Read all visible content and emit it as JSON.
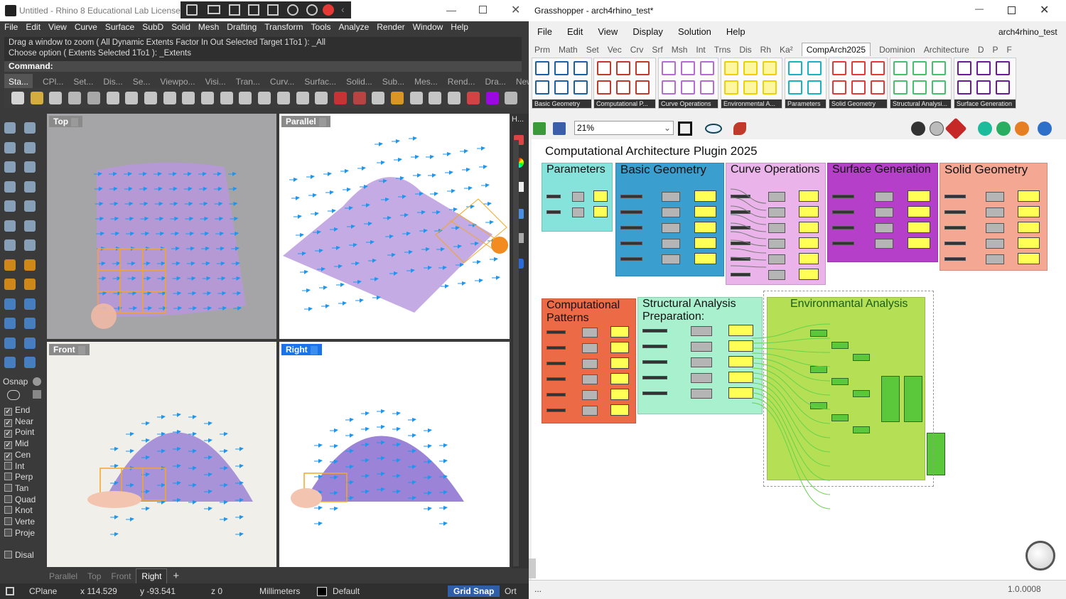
{
  "rhino": {
    "title": "Untitled - Rhino 8 Educational Lab License",
    "menu": [
      "File",
      "Edit",
      "View",
      "Curve",
      "Surface",
      "SubD",
      "Solid",
      "Mesh",
      "Drafting",
      "Transform",
      "Tools",
      "Analyze",
      "Render",
      "Window",
      "Help"
    ],
    "history": [
      "Drag a window to zoom ( All  Dynamic  Extents  Factor  In  Out  Selected  Target  1To1 ): _All",
      "Choose option ( Extents  Selected  1To1 ): _Extents"
    ],
    "command_label": "Command:",
    "toolbar_tabs": [
      "Sta...",
      "CPl...",
      "Set...",
      "Dis...",
      "Se...",
      "Viewpo...",
      "Visi...",
      "Tran...",
      "Curv...",
      "Surfac...",
      "Solid...",
      "Sub...",
      "Mes...",
      "Rend...",
      "Dra...",
      "New..."
    ],
    "viewports": {
      "top": "Top",
      "parallel": "Parallel",
      "front": "Front",
      "right": "Right"
    },
    "view_tabs": [
      "Parallel",
      "Top",
      "Front",
      "Right"
    ],
    "osnap_label": "Osnap",
    "osnaps": [
      {
        "label": "End",
        "checked": true
      },
      {
        "label": "Near",
        "checked": true
      },
      {
        "label": "Point",
        "checked": true
      },
      {
        "label": "Mid",
        "checked": true
      },
      {
        "label": "Cen",
        "checked": true
      },
      {
        "label": "Int",
        "checked": false
      },
      {
        "label": "Perp",
        "checked": false
      },
      {
        "label": "Tan",
        "checked": false
      },
      {
        "label": "Quad",
        "checked": false
      },
      {
        "label": "Knot",
        "checked": false
      },
      {
        "label": "Verte",
        "checked": false
      },
      {
        "label": "Proje",
        "checked": false
      }
    ],
    "disable_label": "Disal",
    "status": {
      "cplane": "CPlane",
      "x": "x 114.529",
      "y": "y -93.541",
      "z": "z 0",
      "units": "Millimeters",
      "layer": "Default",
      "grid_snap": "Grid Snap",
      "ortho": "Ort"
    },
    "right_panel_label": "H..."
  },
  "gh": {
    "title": "Grasshopper - arch4rhino_test*",
    "menu": [
      "File",
      "Edit",
      "View",
      "Display",
      "Solution",
      "Help"
    ],
    "doc_name": "arch4rhino_test",
    "tabs": [
      "Prm",
      "Math",
      "Set",
      "Vec",
      "Crv",
      "Srf",
      "Msh",
      "Int",
      "Trns",
      "Dis",
      "Rh",
      "Ka²",
      "CompArch2025",
      "Dominion",
      "Architecture",
      "D",
      "P",
      "F"
    ],
    "active_tab": "CompArch2025",
    "ribbon_groups": [
      "Basic Geometry",
      "Computational P...",
      "Curve Operations",
      "Environmental A...",
      "Parameters",
      "Solid Geometry",
      "Structural Analysi...",
      "Surface Generation"
    ],
    "zoom": "21%",
    "canvas_title": "Computational Architecture Plugin 2025",
    "groups": [
      {
        "name": "Parameters",
        "color": "#86e3dc"
      },
      {
        "name": "Basic Geometry",
        "color": "#3a9fcf"
      },
      {
        "name": "Curve Operations",
        "color": "#eab4ea"
      },
      {
        "name": "Surface Generation",
        "color": "#b63fc9"
      },
      {
        "name": "Solid Geometry",
        "color": "#f4a894"
      },
      {
        "name": "Computational Patterns",
        "color": "#ec6a45"
      },
      {
        "name": "Structural Analysis Preparation:",
        "color": "#a9f0cf"
      },
      {
        "name": "Environmantal Analysis",
        "color": "#b5e056"
      }
    ],
    "status": "...",
    "version": "1.0.0008"
  },
  "colors": {
    "accent": "#1a73e8",
    "arrow": "#1e96f0",
    "surface": "#b796dc",
    "grid_snap_bg": "#2e5fa8"
  }
}
